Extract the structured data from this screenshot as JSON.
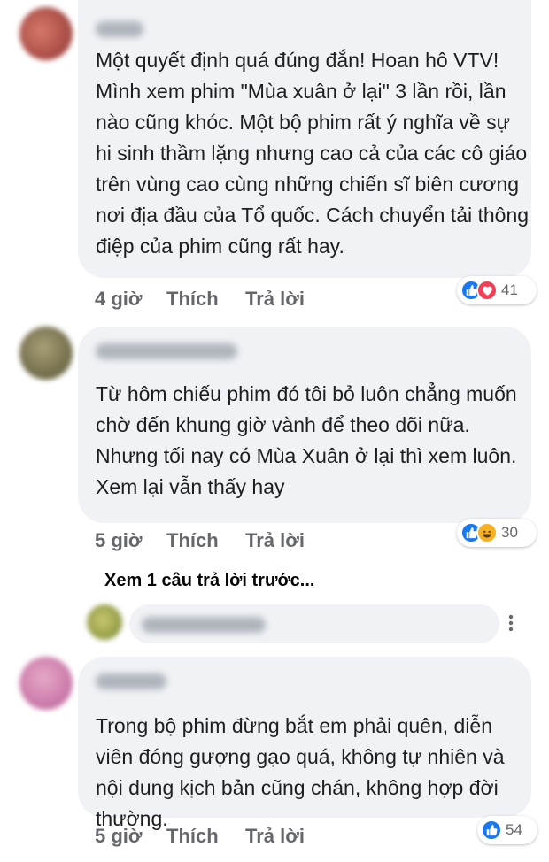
{
  "comments": [
    {
      "text": "Một quyết định quá đúng đắn! Hoan hô VTV! Mình xem phim \"Mùa xuân ở lại\" 3 lần rồi, lần nào cũng khóc. Một bộ phim rất ý nghĩa về sự hi sinh thầm lặng nhưng cao cả của các cô giáo trên vùng cao cùng những chiến sĩ biên cương nơi địa đầu của Tổ quốc. Cách chuyển tải thông điệp của phim cũng rất hay.",
      "time": "4 giờ",
      "like_label": "Thích",
      "reply_label": "Trả lời",
      "reactions": [
        "like-icon",
        "love-icon"
      ],
      "reaction_count": "41"
    },
    {
      "text": "Từ hôm  chiếu phim đó  tôi bỏ luôn chẳng muốn  chờ  đến khung giờ  vành để theo dõi  nữa.  Nhưng  tối nay có  Mùa Xuân  ở  lại thì xem luôn. Xem lại vẫn thấy hay",
      "time": "5 giờ",
      "like_label": "Thích",
      "reply_label": "Trả lời",
      "reactions": [
        "like-icon",
        "haha-icon"
      ],
      "reaction_count": "30"
    },
    {
      "text": "Trong bộ phim đừng bắt em phải quên, diễn viên đóng gượng gạo quá, không tự nhiên  và nội dung kịch bản cũng chán, không hợp đời thường.",
      "time": "5 giờ",
      "like_label": "Thích",
      "reply_label": "Trả lời",
      "reactions": [
        "like-icon"
      ],
      "reaction_count": "54"
    }
  ],
  "view_previous_reply": "Xem 1 câu trả lời trước...",
  "colors": {
    "bubble": "#f0f2f5",
    "like": "#1877f2",
    "love": "#f33e58",
    "haha": "#f7b125",
    "meta_text": "#65676b"
  }
}
